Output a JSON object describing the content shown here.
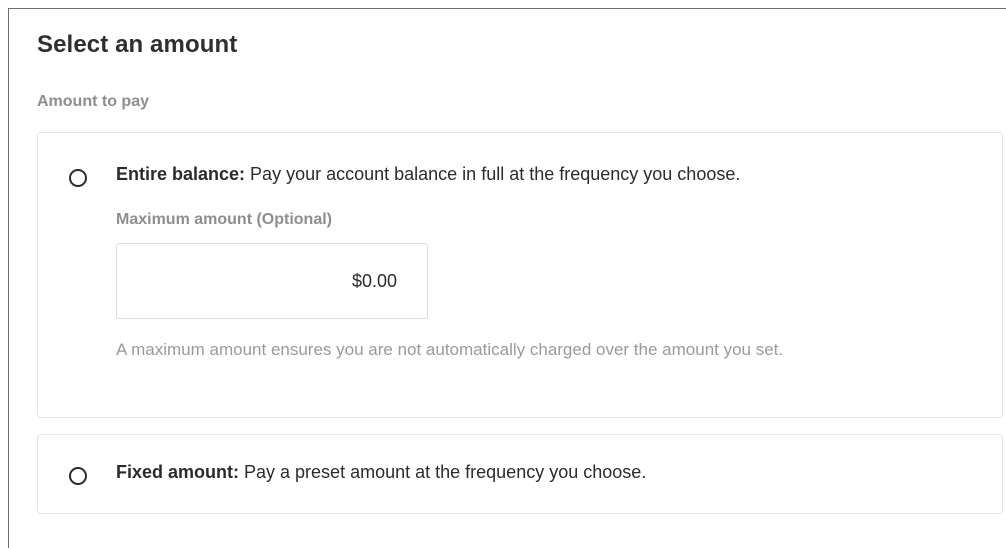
{
  "heading": "Select an amount",
  "amount_section": {
    "label": "Amount to pay",
    "options": [
      {
        "title": "Entire balance:",
        "description": " Pay your account balance in full at the frequency you choose.",
        "selected": false,
        "max_amount": {
          "label": "Maximum amount (Optional)",
          "value": "$0.00",
          "help": "A maximum amount ensures you are not automatically charged over the amount you set."
        }
      },
      {
        "title": "Fixed amount:",
        "description": " Pay a preset amount at the frequency you choose.",
        "selected": false
      }
    ]
  },
  "icons": {
    "radio": "radio-unchecked-icon"
  },
  "colors": {
    "text": "#2b2b2b",
    "muted": "#8e8e8e",
    "border": "#e6e6e6"
  }
}
